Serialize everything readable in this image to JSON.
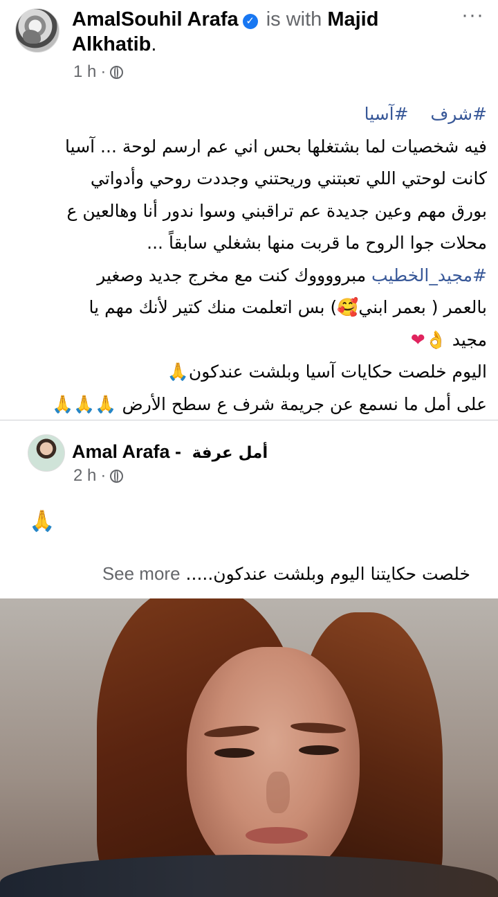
{
  "post": {
    "author": "AmalSouhil Arafa",
    "with_text": "is with",
    "tagged_first": "Majid",
    "tagged_second": "Alkhatib",
    "time": "1 h",
    "separator": "·",
    "more": "···",
    "lines": {
      "hashtags_1": "#شرف",
      "hashtags_2": "#آسيا",
      "l1": "فيه شخصيات لما بشتغلها بحس اني عم ارسم لوحة ... آسيا",
      "l2": "كانت لوحتي اللي تعبتني وريحتني وجددت روحي وأدواتي",
      "l3": "بورق مهم وعين جديدة عم تراقبني وسوا  ندور أنا وهالعين ع",
      "l4": "محلات جوا الروح ما قربت منها بشغلي سابقاً ...",
      "l5_tag": "#مجيد_الخطيب",
      "l5_rest": " مبرووووك كنت مع مخرج جديد وصغير",
      "l6a": "بالعمر ( بعمر ابني",
      "l6_emoji": "🥰",
      "l6b": ") بس اتعلمت منك كتير لأنك مهم يا",
      "l7": "مجيد",
      "l7_emoji1": "👌",
      "l7_emoji2": "❤",
      "l8": "اليوم خلصت حكايات آسيا وبلشت عندكون",
      "l8_emoji": "🙏",
      "l9": "على أمل ما نسمع عن جريمة شرف ع سطح الأرض",
      "l9_emoji": "🙏🙏🙏"
    }
  },
  "shared": {
    "author": "Amal Arafa -",
    "author_ar": "أمل عرفة",
    "time": "2 h",
    "separator": "·",
    "emoji": "🙏",
    "text": "خلصت حكايتنا اليوم وبلشت عندكون.....",
    "see_more": "See more"
  },
  "colors": {
    "hashtag": "#385898",
    "verified": "#1877f2",
    "secondary_text": "#65676b"
  },
  "icons": {
    "verified": "verified-badge-icon",
    "globe": "globe-icon",
    "more": "more-options-icon"
  }
}
